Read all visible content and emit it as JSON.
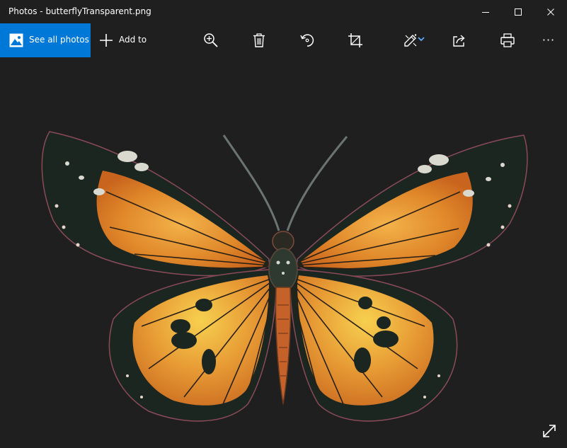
{
  "window": {
    "title": "Photos - butterflyTransparent.png",
    "minimize_icon": "minimize-icon",
    "maximize_icon": "maximize-icon",
    "close_icon": "close-icon"
  },
  "toolbar": {
    "see_all_label": "See all photos",
    "see_all_icon": "photos-icon",
    "add_to_label": "Add to",
    "add_to_icon": "plus-icon",
    "zoom_icon": "zoom-in-icon",
    "delete_icon": "trash-icon",
    "rotate_icon": "rotate-icon",
    "crop_icon": "crop-icon",
    "edit_icon": "edit-create-icon",
    "share_icon": "share-icon",
    "print_icon": "print-icon",
    "more_label": "···"
  },
  "viewer": {
    "image_subject": "butterfly",
    "fullscreen_icon": "expand-icon"
  },
  "colors": {
    "background": "#1f1f1f",
    "accent": "#0078d7",
    "text": "#ffffff",
    "wing_orange": "#e3902f",
    "wing_dark": "#1a2520"
  }
}
